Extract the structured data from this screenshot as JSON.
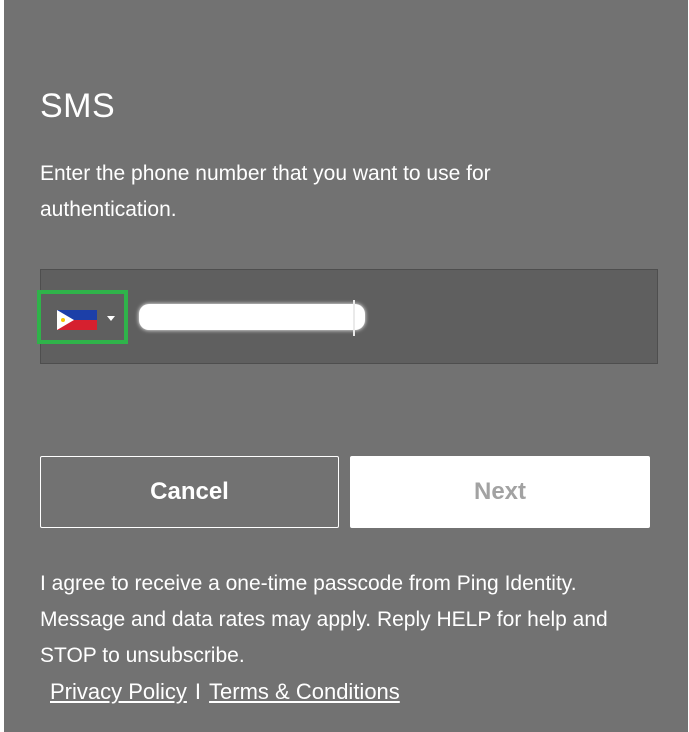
{
  "header": {
    "title": "SMS"
  },
  "description": "Enter the phone number that you want to use for authentication.",
  "phone": {
    "country_flag": "philippines-flag",
    "value": "",
    "value_redacted": true
  },
  "buttons": {
    "cancel_label": "Cancel",
    "next_label": "Next"
  },
  "consent_text": "I agree to receive a one-time passcode from Ping Identity. Message and data rates may apply. Reply HELP for help and STOP to unsubscribe.",
  "links": {
    "privacy": "Privacy Policy",
    "separator": "I",
    "terms": "Terms & Conditions"
  },
  "colors": {
    "panel_bg": "#727272",
    "input_bg": "#5f5f5f",
    "highlight": "#2fb34a",
    "next_text": "#a2a2a2"
  }
}
